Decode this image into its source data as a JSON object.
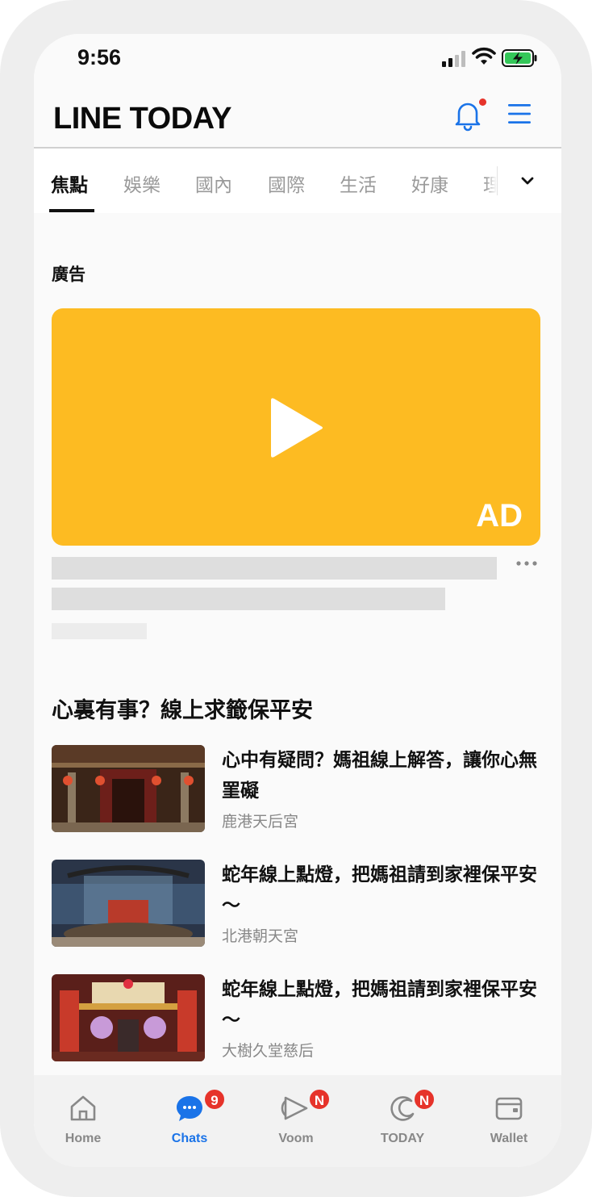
{
  "status_bar": {
    "time": "9:56"
  },
  "header": {
    "logo": "LINE TODAY"
  },
  "tabs": [
    {
      "label": "焦點",
      "active": true
    },
    {
      "label": "娛樂"
    },
    {
      "label": "國內"
    },
    {
      "label": "國際"
    },
    {
      "label": "生活"
    },
    {
      "label": "好康"
    },
    {
      "label": "理"
    }
  ],
  "ad": {
    "section_label": "廣告",
    "badge_text": "AD",
    "box_color": "#fdbb22"
  },
  "section": {
    "title": "心裏有事？線上求籤保平安",
    "items": [
      {
        "title": "心中有疑問？媽祖線上解答，讓你心無罣礙",
        "source": "鹿港天后宮"
      },
      {
        "title": "蛇年線上點燈，把媽祖請到家裡保平安～",
        "source": "北港朝天宮"
      },
      {
        "title": "蛇年線上點燈，把媽祖請到家裡保平安～",
        "source": "大樹久堂慈后"
      }
    ]
  },
  "bottom_nav": [
    {
      "label": "Home",
      "icon": "home-icon"
    },
    {
      "label": "Chats",
      "icon": "chat-bubble-icon",
      "badge": "9",
      "active": true
    },
    {
      "label": "Voom",
      "icon": "voom-icon",
      "badge": "N"
    },
    {
      "label": "TODAY",
      "icon": "today-icon",
      "badge": "N"
    },
    {
      "label": "Wallet",
      "icon": "wallet-icon"
    }
  ],
  "colors": {
    "accent": "#1a73e8",
    "badge": "#e6332a",
    "ad_yellow": "#fdbb22"
  }
}
